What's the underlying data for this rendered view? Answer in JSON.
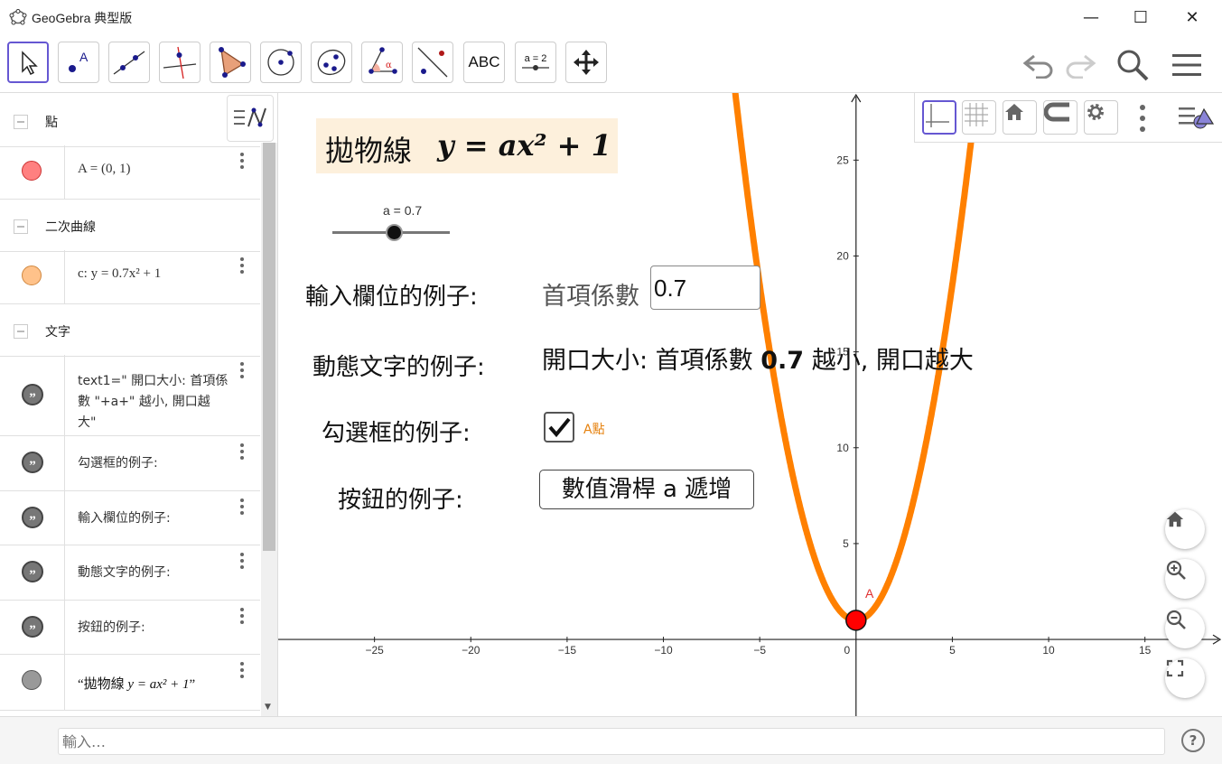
{
  "window": {
    "title": "GeoGebra 典型版",
    "minimize": "—",
    "maximize": "☐",
    "close": "✕"
  },
  "toolbar": {
    "text_tool_label": "ABC",
    "slider_tool_label": "a = 2"
  },
  "algebra": {
    "groups": [
      {
        "label": "點"
      },
      {
        "label": "二次曲線"
      },
      {
        "label": "文字"
      }
    ],
    "items": [
      {
        "text": "A = (0, 1)",
        "color": "#ff8080",
        "border": "#cc3333"
      },
      {
        "text": "c: y = 0.7x² + 1",
        "color": "#ffc28a",
        "border": "#d08840"
      },
      {
        "text_lines": [
          "text1=\" 開口大小: 首項係",
          "數 \"+a+\" 越小, 開口越",
          "大\""
        ]
      },
      {
        "text": "勾選框的例子:"
      },
      {
        "text": "輸入欄位的例子:"
      },
      {
        "text": "動態文字的例子:"
      },
      {
        "text": "按鈕的例子:"
      },
      {
        "text_prefix": "“拋物線 ",
        "text_math": "y = ax² + 1",
        "text_suffix": "”"
      }
    ]
  },
  "graphics": {
    "title_chinese": "拋物線",
    "title_math": "y = ax² + 1",
    "slider_label": "a = 0.7",
    "slider_value": 0.7,
    "input_label": "輸入欄位的例子:",
    "input_caption": "首項係數",
    "input_value": "0.7",
    "dynamic_label": "動態文字的例子:",
    "dynamic_text_prefix": "開口大小: 首項係數 ",
    "dynamic_text_value": "0.7",
    "dynamic_text_suffix": " 越小, 開口越大",
    "checkbox_label": "勾選框的例子:",
    "checkbox_caption": "A點",
    "checkbox_checked": true,
    "button_label": "按鈕的例子:",
    "button_text": "數值滑桿 a 遞增",
    "point_label": "A",
    "x_ticks": [
      "−25",
      "−20",
      "−15",
      "−10",
      "−5",
      "0",
      "5",
      "10",
      "15"
    ],
    "y_ticks": [
      "5",
      "10",
      "15",
      "20",
      "25"
    ]
  },
  "chart_data": {
    "type": "line",
    "series": [
      {
        "name": "c",
        "function": "y = 0.7x² + 1",
        "color": "#ff8000"
      }
    ],
    "points": [
      {
        "name": "A",
        "x": 0,
        "y": 1,
        "color": "#ff0000"
      }
    ],
    "xlim": [
      -30,
      19
    ],
    "ylim": [
      -4,
      28.5
    ],
    "x_ticks": [
      -25,
      -20,
      -15,
      -10,
      -5,
      0,
      5,
      10,
      15
    ],
    "y_ticks": [
      5,
      10,
      15,
      20,
      25
    ],
    "grid": false
  },
  "input_bar": {
    "placeholder": "輸入…"
  },
  "colors": {
    "curve": "#ff8000",
    "point": "#ff0000",
    "selected_tool_border": "#6557d2",
    "title_background": "#fdf0dc"
  }
}
